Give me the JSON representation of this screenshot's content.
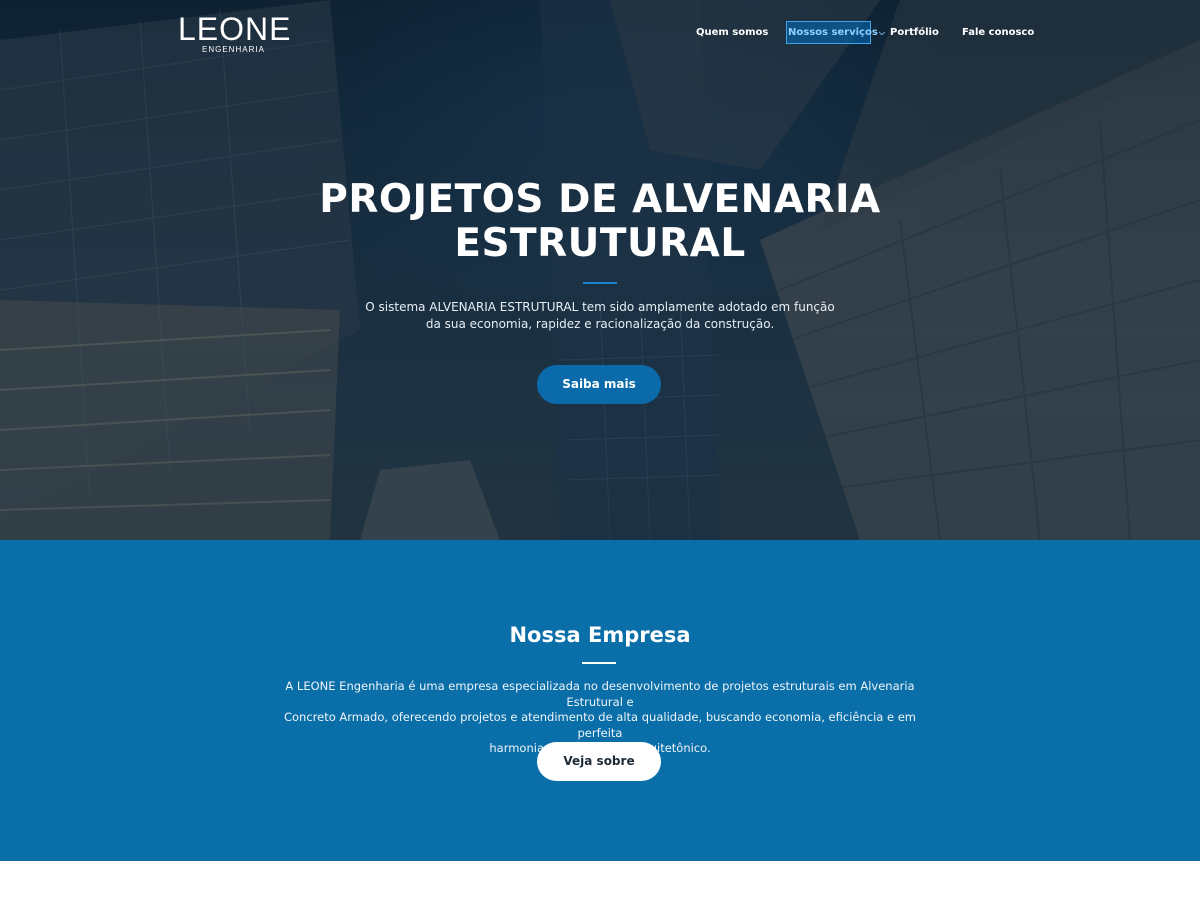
{
  "brand": {
    "logo_main": "LEONE",
    "logo_sub": "ENGENHARIA"
  },
  "nav": {
    "items": [
      {
        "label": "Quem somos"
      },
      {
        "label": "Nossos serviços"
      },
      {
        "label": "Portfólio"
      },
      {
        "label": "Fale conosco"
      }
    ]
  },
  "hero": {
    "title_line1": "PROJETOS DE ALVENARIA",
    "title_line2": "ESTRUTURAL",
    "text_line1": "O sistema ALVENARIA ESTRUTURAL tem sido amplamente adotado em função",
    "text_line2": "da sua economia, rapidez e racionalização da construção.",
    "button_label": "Saiba mais"
  },
  "company": {
    "title": "Nossa Empresa",
    "text_line1": "A LEONE Engenharia é uma empresa especializada no desenvolvimento de projetos estruturais em Alvenaria Estrutural e",
    "text_line2": "Concreto Armado, oferecendo projetos e atendimento de alta qualidade, buscando economia, eficiência e em perfeita",
    "text_line3": "harmonia com o projeto arquitetônico.",
    "button_label": "Veja sobre"
  },
  "colors": {
    "accent": "#0a6aaa",
    "section_blue": "#0a6ea8",
    "nav_active": "#8fd0ff"
  }
}
